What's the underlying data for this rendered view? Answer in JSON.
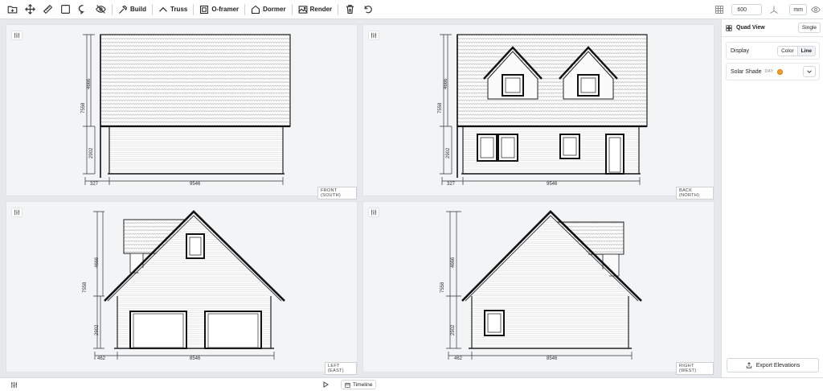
{
  "toolbar": {
    "build_label": "Build",
    "truss_label": "Truss",
    "oframer_label": "O-framer",
    "dormer_label": "Dormer",
    "render_label": "Render",
    "zoom_value": "600",
    "unit_label": "mm"
  },
  "views": [
    {
      "label": "FRONT (SOUTH)",
      "total_height": "7558",
      "roof_height": "4666",
      "wall_height": "2902",
      "overhang": "327",
      "width": "9546"
    },
    {
      "label": "BACK (NORTH)",
      "total_height": "7558",
      "roof_height": "4666",
      "wall_height": "2902",
      "overhang": "327",
      "width": "9546"
    },
    {
      "label": "LEFT (EAST)",
      "total_height": "7558",
      "roof_height": "4666",
      "wall_height": "2902",
      "overhang": "462",
      "width": "8546"
    },
    {
      "label": "RIGHT (WEST)",
      "total_height": "7558",
      "roof_height": "4666",
      "wall_height": "2902",
      "overhang": "462",
      "width": "8546"
    }
  ],
  "sidebar": {
    "title": "Quad View",
    "single_label": "Single",
    "display_label": "Display",
    "color_label": "Color",
    "line_label": "Line",
    "solar_label": "Solar Shade",
    "solar_mode": "DAY",
    "export_label": "Export Elevations"
  },
  "bottom": {
    "timeline_label": "Timeline"
  }
}
